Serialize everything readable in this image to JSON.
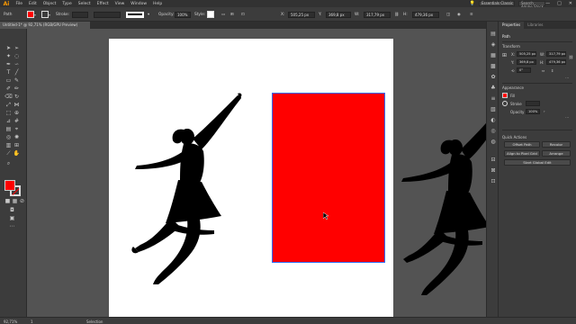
{
  "app": {
    "logo": "Ai"
  },
  "menu": [
    "File",
    "Edit",
    "Object",
    "Type",
    "Select",
    "Effect",
    "View",
    "Window",
    "Help"
  ],
  "workspace": "Essentials Classic",
  "search_placeholder": "Search Adobe Stock",
  "window_controls": [
    "—",
    "□",
    "✕"
  ],
  "control_bar": {
    "selection_label": "Path",
    "stroke_label": "Stroke:",
    "opacity_label": "Opacity:",
    "opacity_value": "100%",
    "style_label": "Style:",
    "x_value": "505,25 px",
    "y_value": "369,8 px",
    "w_value": "317,79 px",
    "h_value": "479,36 px"
  },
  "document_tab": "Untitled-1* @ 92,71% (RGB/GPU Preview)",
  "properties": {
    "tabs": [
      "Properties",
      "Libraries"
    ],
    "selection": "Path",
    "transform_title": "Transform",
    "x": "505,25 px",
    "y": "369,8 px",
    "w": "317,79 px",
    "h": "479,36 px",
    "rotation": "0°",
    "appearance_title": "Appearance",
    "fill_label": "Fill",
    "stroke_label": "Stroke",
    "opacity_label": "Opacity",
    "opacity_value": "100%",
    "quick_actions_title": "Quick Actions",
    "offset_path": "Offset Path",
    "recolor": "Recolor",
    "align_to_pixel": "Align to Pixel Grid",
    "arrange": "Arrange",
    "start_global_edit": "Start Global Edit"
  },
  "status": {
    "zoom": "92,71%",
    "artboard_num": "1",
    "tool": "Selection"
  },
  "colors": {
    "fill": "#ff0000",
    "ui_dark": "#3c3c3c",
    "canvas_bg": "#535353"
  }
}
